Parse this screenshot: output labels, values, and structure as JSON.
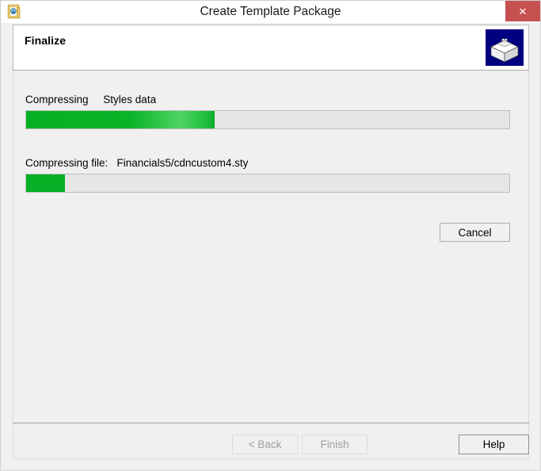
{
  "window": {
    "title": "Create Template Package",
    "icon": "template-package-icon",
    "close_label": "✕"
  },
  "header": {
    "step_title": "Finalize",
    "art_icon": "package-box-icon",
    "art_background": "#000080"
  },
  "main": {
    "overall": {
      "label": "Compressing     Styles data",
      "progress_percent": 39,
      "fill_color": "#06b025",
      "track_color": "#e6e6e6"
    },
    "current_file": {
      "label": "Compressing file:   Financials5/cdncustom4.sty",
      "progress_percent": 8,
      "fill_color": "#06b025",
      "track_color": "#e6e6e6"
    },
    "cancel_label": "Cancel"
  },
  "footer": {
    "back_label": "< Back",
    "finish_label": "Finish",
    "help_label": "Help"
  }
}
